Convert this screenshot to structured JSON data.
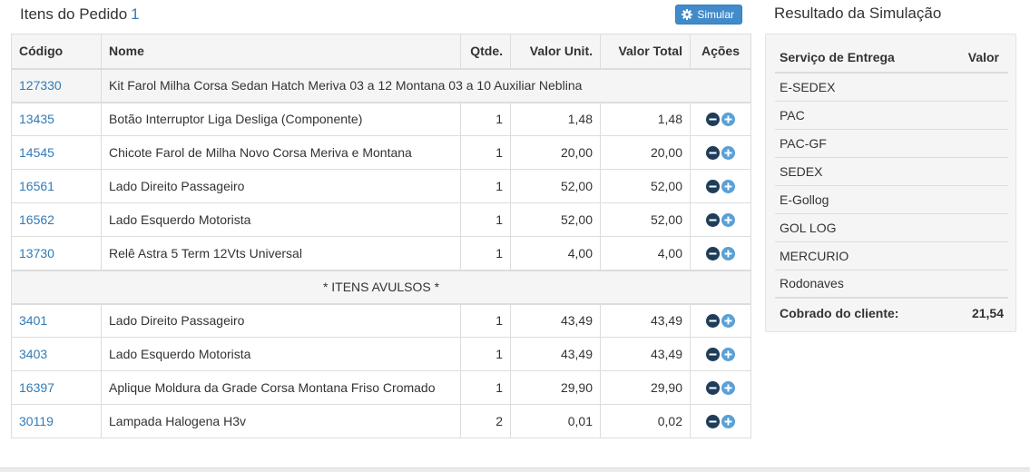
{
  "header": {
    "title": "Itens do Pedido",
    "count": "1",
    "simulate_label": "Simular"
  },
  "table": {
    "columns": [
      "Código",
      "Nome",
      "Qtde.",
      "Valor Unit.",
      "Valor Total",
      "Ações"
    ],
    "group": {
      "code": "127330",
      "name": "Kit Farol Milha Corsa Sedan Hatch Meriva 03 a 12 Montana 03 a 10 Auxiliar Neblina"
    },
    "kit_items": [
      {
        "code": "13435",
        "name": "Botão Interruptor Liga Desliga (Componente)",
        "qty": "1",
        "unit": "1,48",
        "total": "1,48"
      },
      {
        "code": "14545",
        "name": "Chicote Farol de Milha Novo Corsa Meriva e Montana",
        "qty": "1",
        "unit": "20,00",
        "total": "20,00"
      },
      {
        "code": "16561",
        "name": "Lado Direito Passageiro",
        "qty": "1",
        "unit": "52,00",
        "total": "52,00"
      },
      {
        "code": "16562",
        "name": "Lado Esquerdo Motorista",
        "qty": "1",
        "unit": "52,00",
        "total": "52,00"
      },
      {
        "code": "13730",
        "name": "Relê Astra 5 Term 12Vts Universal",
        "qty": "1",
        "unit": "4,00",
        "total": "4,00"
      }
    ],
    "section_label": "* ITENS AVULSOS *",
    "loose_items": [
      {
        "code": "3401",
        "name": "Lado Direito Passageiro",
        "qty": "1",
        "unit": "43,49",
        "total": "43,49"
      },
      {
        "code": "3403",
        "name": "Lado Esquerdo Motorista",
        "qty": "1",
        "unit": "43,49",
        "total": "43,49"
      },
      {
        "code": "16397",
        "name": "Aplique Moldura da Grade Corsa Montana Friso Cromado",
        "qty": "1",
        "unit": "29,90",
        "total": "29,90"
      },
      {
        "code": "30119",
        "name": "Lampada Halogena H3v",
        "qty": "2",
        "unit": "0,01",
        "total": "0,02"
      }
    ]
  },
  "simulation": {
    "title": "Resultado da Simulação",
    "col_service": "Serviço de Entrega",
    "col_value": "Valor",
    "services": [
      {
        "name": "E-SEDEX",
        "value": ""
      },
      {
        "name": "PAC",
        "value": ""
      },
      {
        "name": "PAC-GF",
        "value": ""
      },
      {
        "name": "SEDEX",
        "value": ""
      },
      {
        "name": "E-Gollog",
        "value": ""
      },
      {
        "name": "GOL LOG",
        "value": ""
      },
      {
        "name": "MERCURIO",
        "value": ""
      },
      {
        "name": "Rodonaves",
        "value": ""
      }
    ],
    "charged_label": "Cobrado do cliente:",
    "charged_value": "21,54"
  },
  "icons": {
    "simulate": "gear-icon",
    "remove": "minus-circle-icon",
    "add": "plus-circle-icon"
  },
  "colors": {
    "link": "#337ab7",
    "button": "#428bca",
    "minus_icon": "#1e3d5a",
    "plus_icon": "#5aa0d6",
    "panel_bg": "#f5f5f5"
  }
}
